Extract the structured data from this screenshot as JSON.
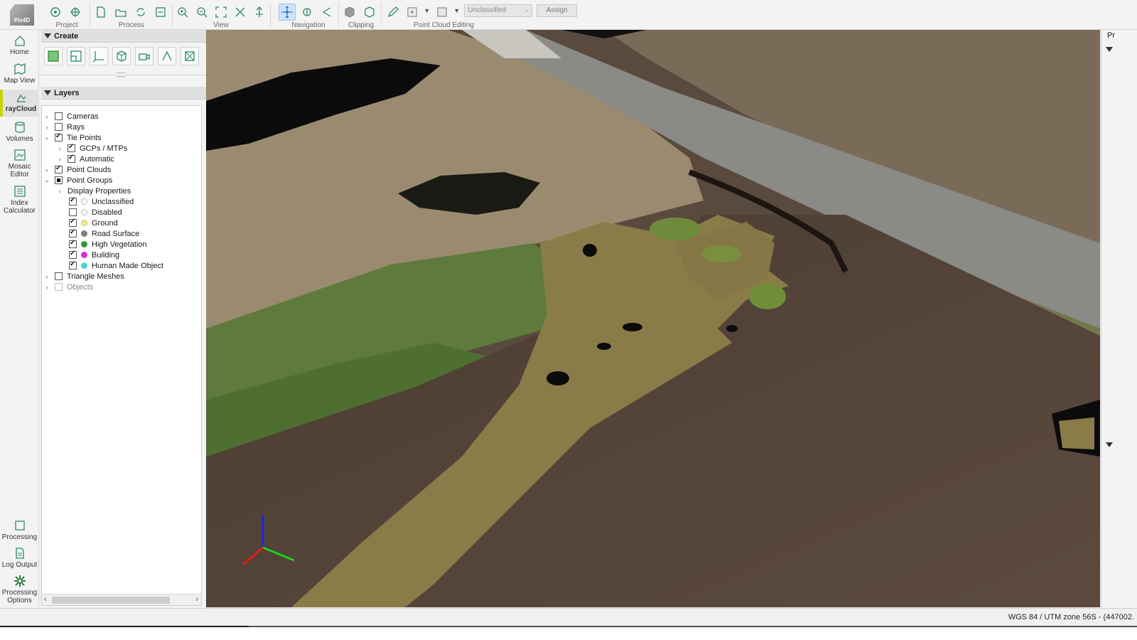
{
  "toolbar": {
    "logo_text": "Pix4D",
    "groups": {
      "project": "Project",
      "process": "Process",
      "view": "View",
      "navigation": "Navigation",
      "clipping": "Clipping",
      "point_cloud_editing": "Point Cloud Editing"
    },
    "class_select_value": "Unclassified",
    "assign_label": "Assign"
  },
  "leftnav": {
    "items": [
      "Home",
      "Map View",
      "rayCloud",
      "Volumes",
      "Mosaic Editor",
      "Index Calculator"
    ],
    "bottom_items": [
      "Processing",
      "Log Output",
      "Processing Options"
    ]
  },
  "panel": {
    "create_title": "Create",
    "layers_title": "Layers",
    "layers": {
      "cameras": "Cameras",
      "rays": "Rays",
      "tie_points": "Tie Points",
      "gcps": "GCPs / MTPs",
      "automatic": "Automatic",
      "point_clouds": "Point Clouds",
      "point_groups": "Point Groups",
      "display_properties": "Display Properties",
      "groups": [
        {
          "label": "Unclassified",
          "color": "#ffffff",
          "checked": true
        },
        {
          "label": "Disabled",
          "color": "#ffffff",
          "checked": false
        },
        {
          "label": "Ground",
          "color": "#f2ee8c",
          "checked": true
        },
        {
          "label": "Road Surface",
          "color": "#7f7f7f",
          "checked": true
        },
        {
          "label": "High Vegetation",
          "color": "#2e9c2e",
          "checked": true
        },
        {
          "label": "Building",
          "color": "#e02ad4",
          "checked": true
        },
        {
          "label": "Human Made Object",
          "color": "#47d6d6",
          "checked": true
        }
      ],
      "triangle_meshes": "Triangle Meshes",
      "objects": "Objects"
    }
  },
  "rightstrip": {
    "label": "Pr"
  },
  "status": {
    "coords": "WGS 84 / UTM zone 56S - (447002."
  },
  "colors": {
    "accent_active": "#c8d300",
    "nav_active_bg": "#cfe3f7"
  }
}
